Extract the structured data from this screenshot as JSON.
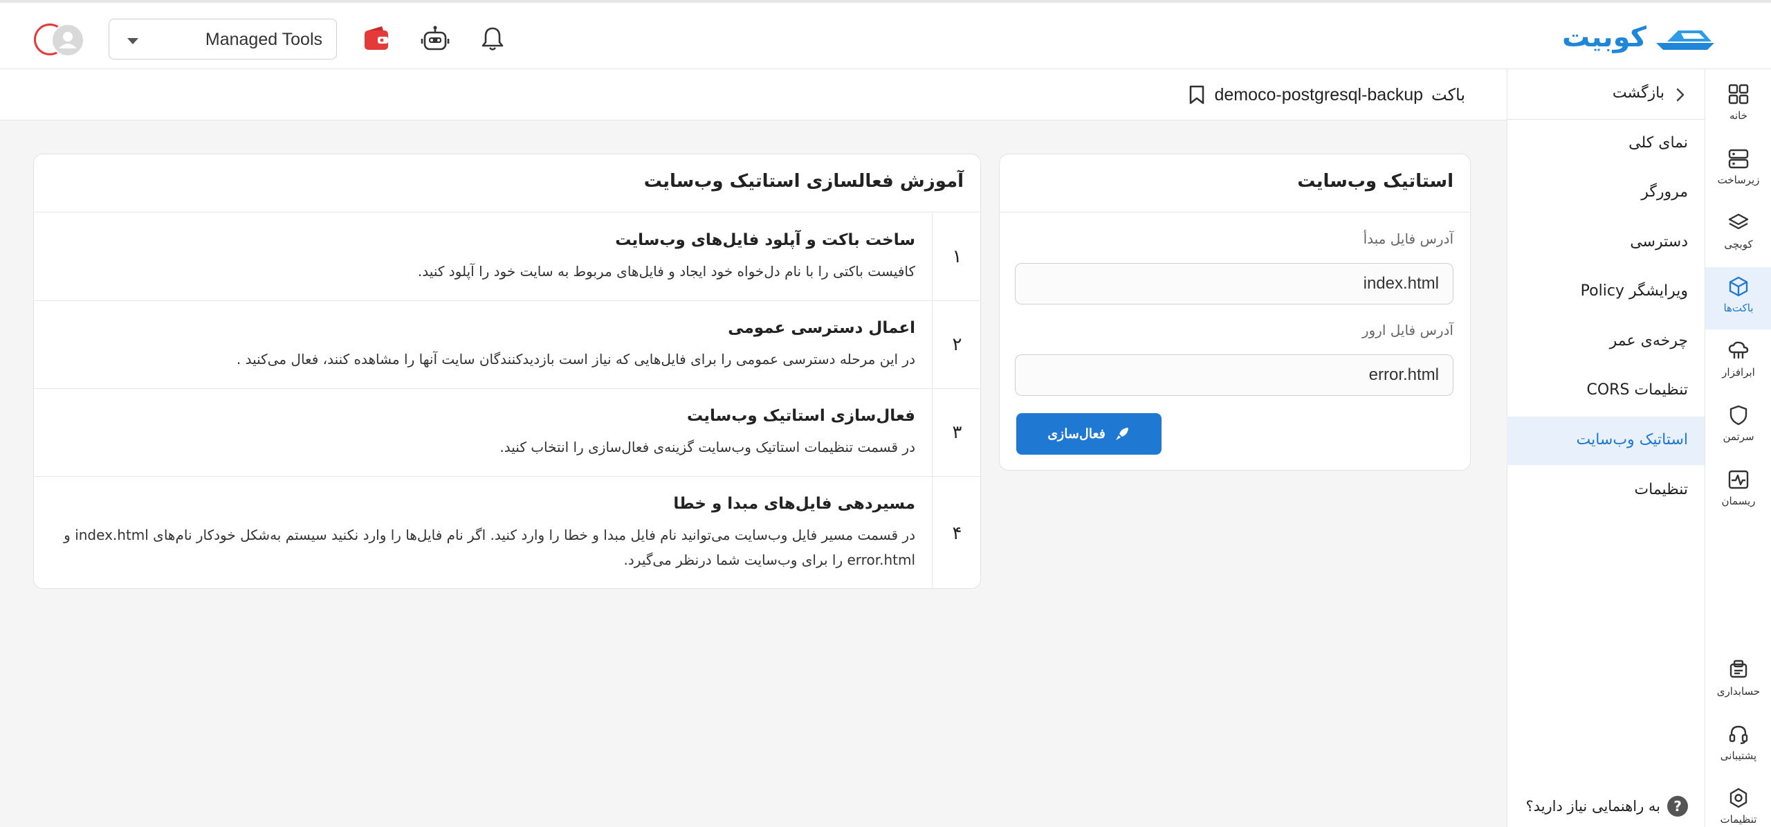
{
  "header": {
    "brand_name": "کوبیت",
    "tools_select_value": "Managed Tools"
  },
  "rail": {
    "items": [
      {
        "label": "خانه",
        "icon": "grid-icon"
      },
      {
        "label": "زیرساخت",
        "icon": "server-icon"
      },
      {
        "label": "کوبچی",
        "icon": "layers-icon"
      },
      {
        "label": "باکت‌ها",
        "icon": "cube-icon"
      },
      {
        "label": "ابرافزار",
        "icon": "cloud-app-icon"
      },
      {
        "label": "سرتمن",
        "icon": "shield-icon"
      },
      {
        "label": "ریسمان",
        "icon": "pulse-icon"
      },
      {
        "label": "حسابداری",
        "icon": "receipt-icon"
      },
      {
        "label": "پشتیبانی",
        "icon": "headset-icon"
      },
      {
        "label": "تنظیمات",
        "icon": "settings-icon"
      }
    ]
  },
  "subnav": {
    "back_label": "بازگشت",
    "items": [
      {
        "label": "نمای کلی"
      },
      {
        "label": "مرورگر"
      },
      {
        "label": "دسترسی"
      },
      {
        "label": "ویرایشگر Policy"
      },
      {
        "label": "چرخه‌ی عمر"
      },
      {
        "label": "تنظیمات CORS"
      },
      {
        "label": "استاتیک وب‌سایت"
      },
      {
        "label": "تنظیمات"
      }
    ],
    "help_label": "به راهنمایی نیاز دارید؟",
    "help_icon_text": "?"
  },
  "page": {
    "title_prefix": "باکت",
    "bucket_name": "democo-postgresql-backup"
  },
  "static_site": {
    "title": "استاتیک وب‌سایت",
    "index_label": "آدرس فایل مبدأ",
    "index_value": "index.html",
    "error_label": "آدرس فایل ارور",
    "error_value": "error.html",
    "activate_label": "فعال‌سازی"
  },
  "guide": {
    "title": "آموزش فعالسازی استاتیک وب‌سایت",
    "steps": [
      {
        "num": "۱",
        "title": "ساخت باکت و آپلود فایل‌های وب‌سایت",
        "desc": "کافیست باکتی را با نام دل‌خواه خود ایجاد و فایل‌های مربوط به سایت خود را آپلود کنید."
      },
      {
        "num": "۲",
        "title": "اعمال دسترسی عمومی",
        "desc": "در این مرحله دسترسی عمومی را برای فایل‌هایی که نیاز است بازدیدکنندگان سایت آنها را مشاهده کنند، فعال می‌کنید ."
      },
      {
        "num": "۳",
        "title": "فعال‌سازی استاتیک وب‌سایت",
        "desc": "در قسمت تنظیمات استاتیک وب‌سایت گزینه‌ی فعال‌سازی را انتخاب کنید."
      },
      {
        "num": "۴",
        "title": "مسیردهی فایل‌های مبدا و خطا",
        "desc": "در قسمت مسیر فایل وب‌سایت می‌توانید نام فایل مبدا و خطا را وارد کنید. اگر نام فایل‌ها را وارد نکنید سیستم به‌شکل خودکار نام‌های index.html و error.html را برای وب‌سایت شما درنظر می‌گیرد."
      }
    ]
  },
  "colors": {
    "accent": "#1f78d1",
    "active_bg": "#e7f0fb",
    "wallet_red": "#e53a3a"
  }
}
